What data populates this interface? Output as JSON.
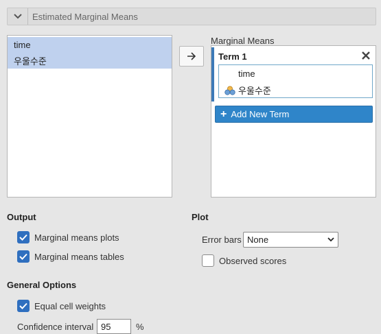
{
  "section": {
    "title": "Estimated Marginal Means",
    "icon": "chevron-down-icon"
  },
  "variables": [
    {
      "label": "time"
    },
    {
      "label": "우울수준"
    }
  ],
  "move_button": {
    "icon": "arrow-right-icon"
  },
  "marginal_means": {
    "label": "Marginal Means",
    "terms": [
      {
        "title": "Term 1",
        "items": [
          {
            "label": "time",
            "icon": null
          },
          {
            "label": "우울수준",
            "icon": "nominal-variable-icon"
          }
        ]
      }
    ],
    "add_button": "Add New Term"
  },
  "output": {
    "title": "Output",
    "plots_label": "Marginal means plots",
    "plots_checked": true,
    "tables_label": "Marginal means tables",
    "tables_checked": true
  },
  "plot": {
    "title": "Plot",
    "error_bars_label": "Error bars",
    "error_bars_value": "None",
    "observed_label": "Observed scores",
    "observed_checked": false
  },
  "general": {
    "title": "General Options",
    "equal_label": "Equal cell weights",
    "equal_checked": true,
    "ci_label": "Confidence interval",
    "ci_value": "95",
    "ci_unit": "%"
  },
  "colors": {
    "accent": "#2f6fbf",
    "button": "#2f85c9",
    "selection": "#bfd1ee"
  }
}
